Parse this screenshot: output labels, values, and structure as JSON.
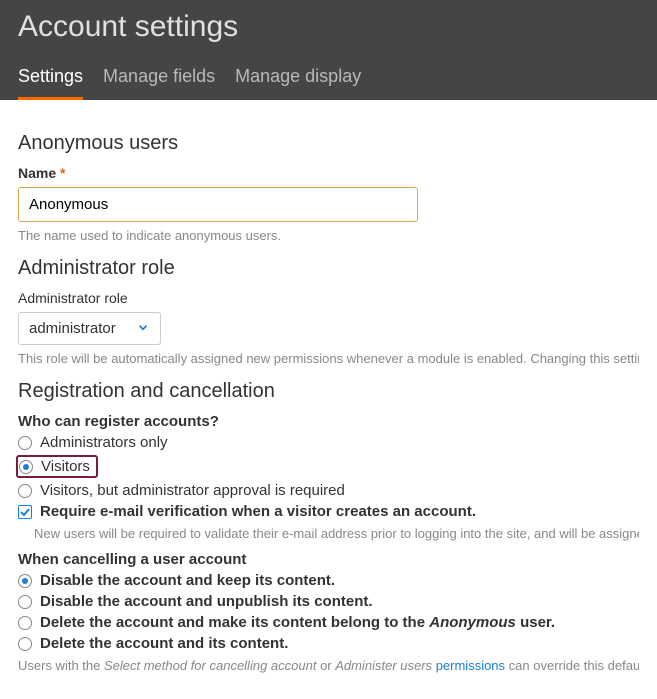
{
  "header": {
    "title": "Account settings",
    "tabs": [
      {
        "label": "Settings",
        "active": true
      },
      {
        "label": "Manage fields",
        "active": false
      },
      {
        "label": "Manage display",
        "active": false
      }
    ]
  },
  "anonymous": {
    "heading": "Anonymous users",
    "name_label": "Name",
    "required_mark": "*",
    "name_value": "Anonymous",
    "name_help": "The name used to indicate anonymous users."
  },
  "admin_role": {
    "heading": "Administrator role",
    "label": "Administrator role",
    "selected": "administrator",
    "help": "This role will be automatically assigned new permissions whenever a module is enabled. Changing this setting will not a"
  },
  "registration": {
    "heading": "Registration and cancellation",
    "who_label": "Who can register accounts?",
    "options": {
      "admins_only": "Administrators only",
      "visitors": "Visitors",
      "visitors_approval": "Visitors, but administrator approval is required"
    },
    "require_email_label": "Require e-mail verification when a visitor creates an account.",
    "require_email_help": "New users will be required to validate their e-mail address prior to logging into the site, and will be assigned a system",
    "cancel_label": "When cancelling a user account",
    "cancel_options": {
      "disable_keep": "Disable the account and keep its content.",
      "disable_unpublish": "Disable the account and unpublish its content.",
      "delete_anon_pre": "Delete the account and make its content belong to the ",
      "delete_anon_em": "Anonymous",
      "delete_anon_post": " user.",
      "delete_all": "Delete the account and its content."
    },
    "cancel_help_pre": "Users with the ",
    "cancel_help_em1": "Select method for cancelling account",
    "cancel_help_mid": " or ",
    "cancel_help_em2": "Administer users",
    "cancel_help_space": " ",
    "cancel_help_link": "permissions",
    "cancel_help_post": " can override this default method"
  }
}
